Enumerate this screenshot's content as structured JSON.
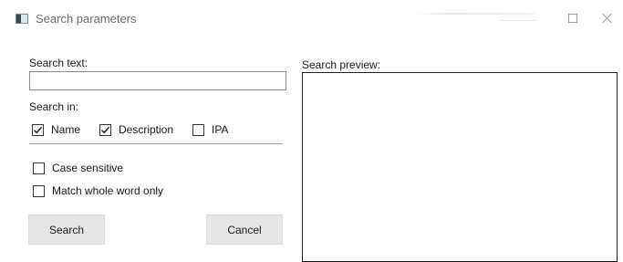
{
  "window": {
    "title": "Search parameters",
    "icon": "app-window-icon",
    "controls": [
      "maximize-icon",
      "close-icon"
    ]
  },
  "form": {
    "search_text_label": "Search text:",
    "search_text_value": "",
    "search_in_label": "Search in:",
    "search_in_options": [
      {
        "label": "Name",
        "checked": true
      },
      {
        "label": "Description",
        "checked": true
      },
      {
        "label": "IPA",
        "checked": false
      }
    ],
    "options": [
      {
        "label": "Case sensitive",
        "checked": false
      },
      {
        "label": "Match whole word only",
        "checked": false
      }
    ],
    "search_button": "Search",
    "cancel_button": "Cancel"
  },
  "preview": {
    "label": "Search preview:",
    "content": ""
  }
}
